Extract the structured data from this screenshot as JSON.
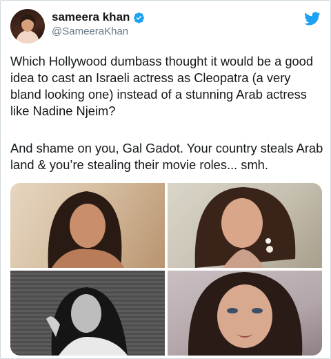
{
  "tweet": {
    "display_name": "sameera khan",
    "handle": "@SameeraKhan",
    "paragraph_1": "Which Hollywood dumbass thought it would be a good idea to cast an Israeli actress as Cleopatra (a very bland looking one) instead of a stunning Arab actress like Nadine Njeim?",
    "paragraph_2": "And shame on you, Gal Gadot. Your country steals Arab land & you’re stealing their movie roles... smh.",
    "photo_count": 4
  },
  "icons": {
    "verified": "verified-badge-icon",
    "brand": "twitter-bird-icon"
  },
  "colors": {
    "brand_blue": "#1da1f2",
    "text": "#14171a",
    "secondary_text": "#657786",
    "border": "#cfd9de"
  }
}
